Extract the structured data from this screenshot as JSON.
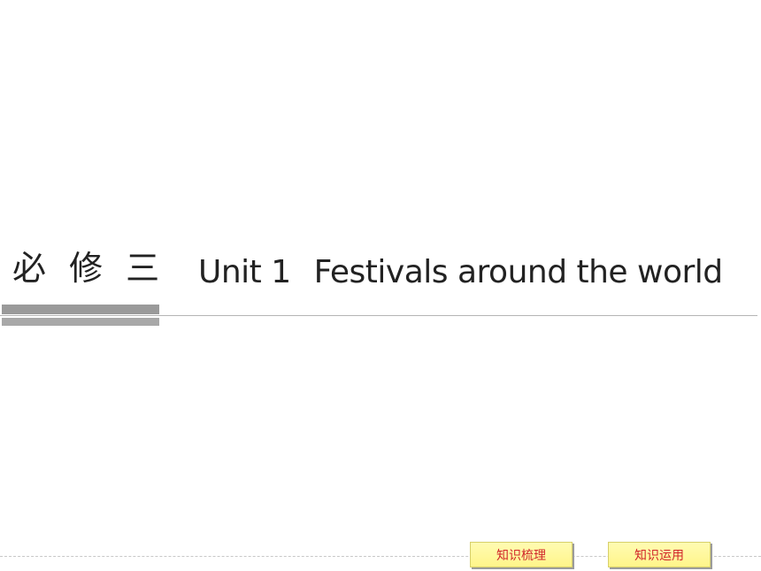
{
  "slide": {
    "module_label": "必 修 三",
    "unit_number": "Unit 1",
    "unit_title": "Festivals around the world"
  },
  "footer": {
    "buttons": [
      {
        "label": "知识梳理"
      },
      {
        "label": "知识运用"
      }
    ]
  },
  "colors": {
    "title_text": "#222222",
    "button_bg": "#fff58a",
    "button_text": "#d1262a",
    "bar_gray": "#9a9a9a"
  }
}
